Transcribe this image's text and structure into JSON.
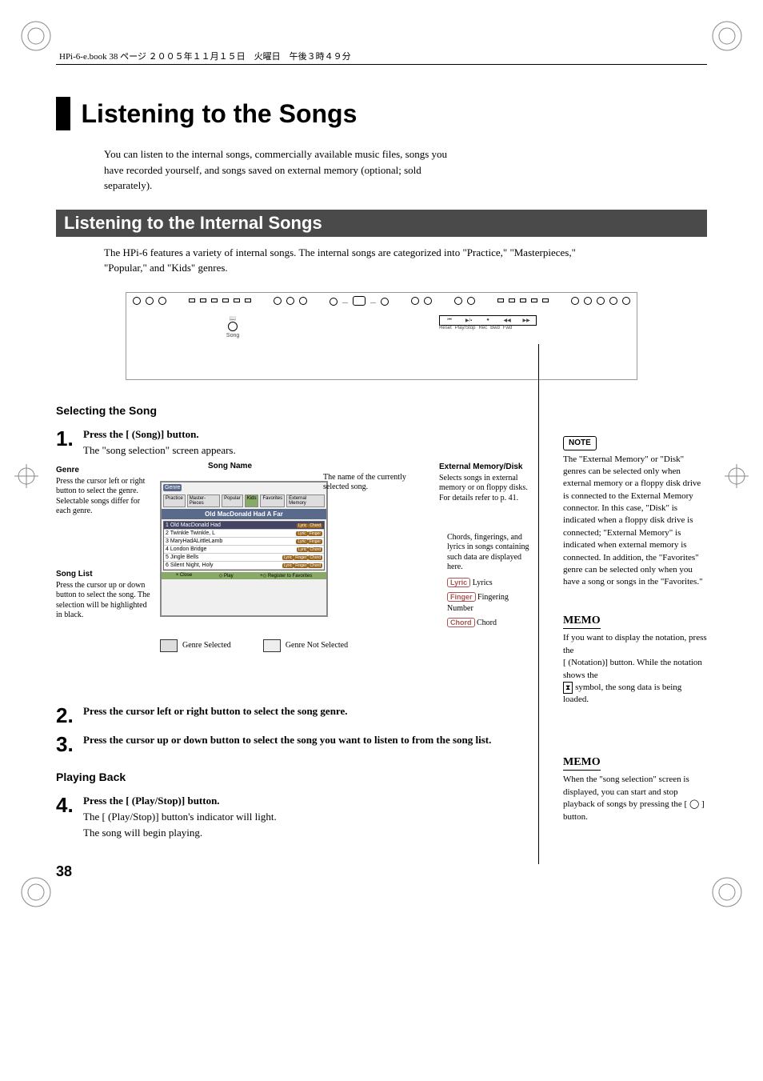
{
  "header_note": "HPi-6-e.book 38 ページ ２００５年１１月１５日　火曜日　午後３時４９分",
  "page_title": "Listening to the Songs",
  "intro": "You can listen to the internal songs, commercially available music files, songs you have recorded yourself, and songs saved on external memory (optional; sold separately).",
  "section_title": "Listening to the Internal Songs",
  "section_intro": "The HPi-6 features a variety of internal songs. The internal songs are categorized into \"Practice,\" \"Masterpieces,\" \"Popular,\" and \"Kids\" genres.",
  "panel": {
    "song_label": "Song",
    "transport": [
      "Reset",
      "Play/Stop",
      "Rec",
      "Bwd",
      "Fwd"
    ]
  },
  "selecting_heading": "Selecting the Song",
  "steps": {
    "s1": {
      "num": "1.",
      "text": "Press the [       (Song)] button.",
      "sub": "The \"song selection\" screen appears."
    },
    "s2": {
      "num": "2.",
      "text": "Press the         cursor left or right button to select the song genre."
    },
    "s3": {
      "num": "3.",
      "text": "Press the         cursor up or down button to select the song you want to listen to from the song list."
    },
    "s4": {
      "num": "4.",
      "text": "Press the [        (Play/Stop)] button.",
      "sub1": "The [        (Play/Stop)] button's indicator will light.",
      "sub2": "The song will begin playing."
    }
  },
  "annotations": {
    "genre_h": "Genre",
    "genre_t": "Press the        cursor left or right button to select the genre. Selectable songs differ for each genre.",
    "songlist_h": "Song List",
    "songlist_t": "Press the        cursor up or down button to select the song. The selection will be highlighted in black.",
    "songname_h": "Song Name",
    "songname_t": "The name of the currently selected song.",
    "ext_h": "External Memory/Disk",
    "ext_t": "Selects songs in external memory or on floppy disks. For details refer to p. 41.",
    "lyrics_t": "Chords, fingerings, and lyrics in songs containing such data are displayed here.",
    "lyric_tag": "Lyric",
    "lyric_l": "Lyrics",
    "finger_tag": "Finger",
    "finger_l": "Fingering Number",
    "chord_tag": "Chord",
    "chord_l": "Chord",
    "genre_sel": "Genre Selected",
    "genre_not": "Genre Not Selected"
  },
  "screen": {
    "title_bar": "Old MacDonald Had A Far",
    "genre_label": "Genre",
    "genres": [
      "Practice",
      "Master-Pieces",
      "Popular",
      "Kids",
      "Favorites",
      "External Memory"
    ],
    "songs": [
      {
        "n": "1",
        "t": "Old MacDonald Had",
        "tags": [
          "Lyric",
          "Chord"
        ]
      },
      {
        "n": "2",
        "t": "Twinkle Twinkle, L",
        "tags": [
          "Lyric",
          "Finger"
        ]
      },
      {
        "n": "3",
        "t": "MaryHadALittleLamb",
        "tags": [
          "Lyric",
          "Finger"
        ]
      },
      {
        "n": "4",
        "t": "London Bridge",
        "tags": [
          "Lyric",
          "Chord"
        ]
      },
      {
        "n": "5",
        "t": "Jingle Bells",
        "tags": [
          "Lyric",
          "Finger",
          "Chord"
        ]
      },
      {
        "n": "6",
        "t": "Silent Night, Holy",
        "tags": [
          "Lyric",
          "Finger",
          "Chord"
        ]
      }
    ],
    "bottom": [
      "× Close",
      "◇ Play",
      "   +◇ Register to Favorites"
    ]
  },
  "playing_heading": "Playing Back",
  "side": {
    "note_label": "NOTE",
    "note_text": "The \"External Memory\" or \"Disk\" genres can be selected only when external memory or a floppy disk drive is connected to the External Memory connector. In this case, \"Disk\" is indicated when a floppy disk drive is connected; \"External Memory\" is indicated when external memory is connected. In addition, the \"Favorites\" genre can be selected only when you have a song or songs in the \"Favorites.\"",
    "memo1_label": "MEMO",
    "memo1_a": "If you want to display the notation, press the",
    "memo1_b": "[      (Notation)] button. While the notation shows the",
    "memo1_c": " symbol, the song data is being loaded.",
    "memo2_label": "MEMO",
    "memo2_text": "When the \"song selection\" screen is displayed, you can start and stop playback of songs by pressing the [ ◯ ] button."
  },
  "page_num": "38"
}
